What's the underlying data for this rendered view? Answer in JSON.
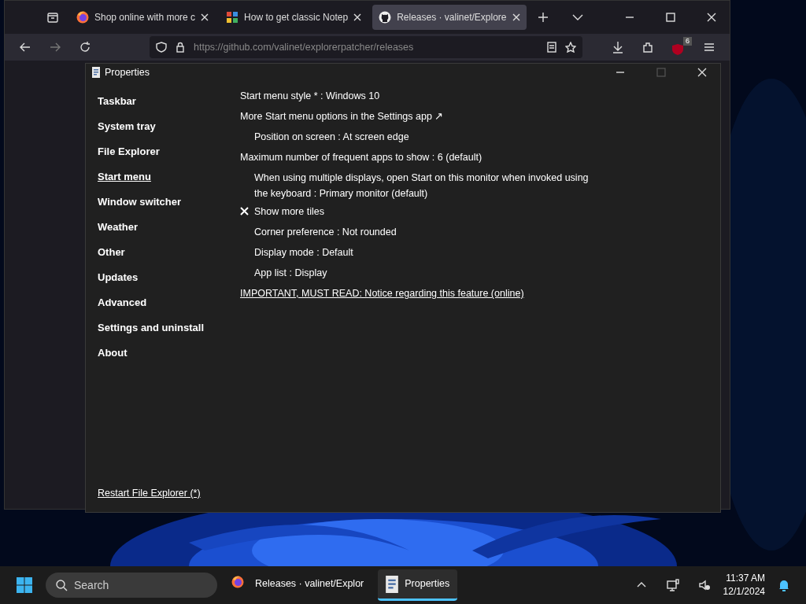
{
  "browser": {
    "tabs": [
      {
        "title": "Shop online with more c",
        "selected": false
      },
      {
        "title": "How to get classic Notep",
        "selected": false
      },
      {
        "title": "Releases · valinet/Explore",
        "selected": true
      }
    ],
    "url": "https://github.com/valinet/explorerpatcher/releases",
    "extension_badge": "6"
  },
  "dialog": {
    "title": "Properties",
    "sidebar": [
      {
        "label": "Taskbar",
        "selected": false
      },
      {
        "label": "System tray",
        "selected": false
      },
      {
        "label": "File Explorer",
        "selected": false
      },
      {
        "label": "Start menu",
        "selected": true
      },
      {
        "label": "Window switcher",
        "selected": false
      },
      {
        "label": "Weather",
        "selected": false
      },
      {
        "label": "Other",
        "selected": false
      },
      {
        "label": "Updates",
        "selected": false
      },
      {
        "label": "Advanced",
        "selected": false
      },
      {
        "label": "Settings and uninstall",
        "selected": false
      },
      {
        "label": "About",
        "selected": false
      }
    ],
    "settings": [
      {
        "kind": "setting",
        "text": "Start menu style * : Windows 10"
      },
      {
        "kind": "external",
        "text": "More Start menu options in the Settings app ↗"
      },
      {
        "kind": "subsetting",
        "text": "Position on screen : At screen edge"
      },
      {
        "kind": "setting",
        "text": "Maximum number of frequent apps to show : 6 (default)"
      },
      {
        "kind": "subsetting",
        "text": "When using multiple displays, open Start on this monitor when invoked using the keyboard : Primary monitor (default)"
      },
      {
        "kind": "checkbox",
        "text": "Show more tiles",
        "checked": false
      },
      {
        "kind": "subsetting",
        "text": "Corner preference : Not rounded"
      },
      {
        "kind": "subsetting",
        "text": "Display mode : Default"
      },
      {
        "kind": "subsetting",
        "text": "App list : Display"
      },
      {
        "kind": "link",
        "text": "IMPORTANT, MUST READ: Notice regarding this feature (online)"
      }
    ],
    "footer_link": "Restart File Explorer (*)"
  },
  "taskbar": {
    "search_placeholder": "Search",
    "apps": [
      {
        "label": "Releases · valinet/Explor",
        "selected": false
      },
      {
        "label": "Properties",
        "selected": true
      }
    ],
    "time": "11:37 AM",
    "date": "12/1/2024"
  }
}
